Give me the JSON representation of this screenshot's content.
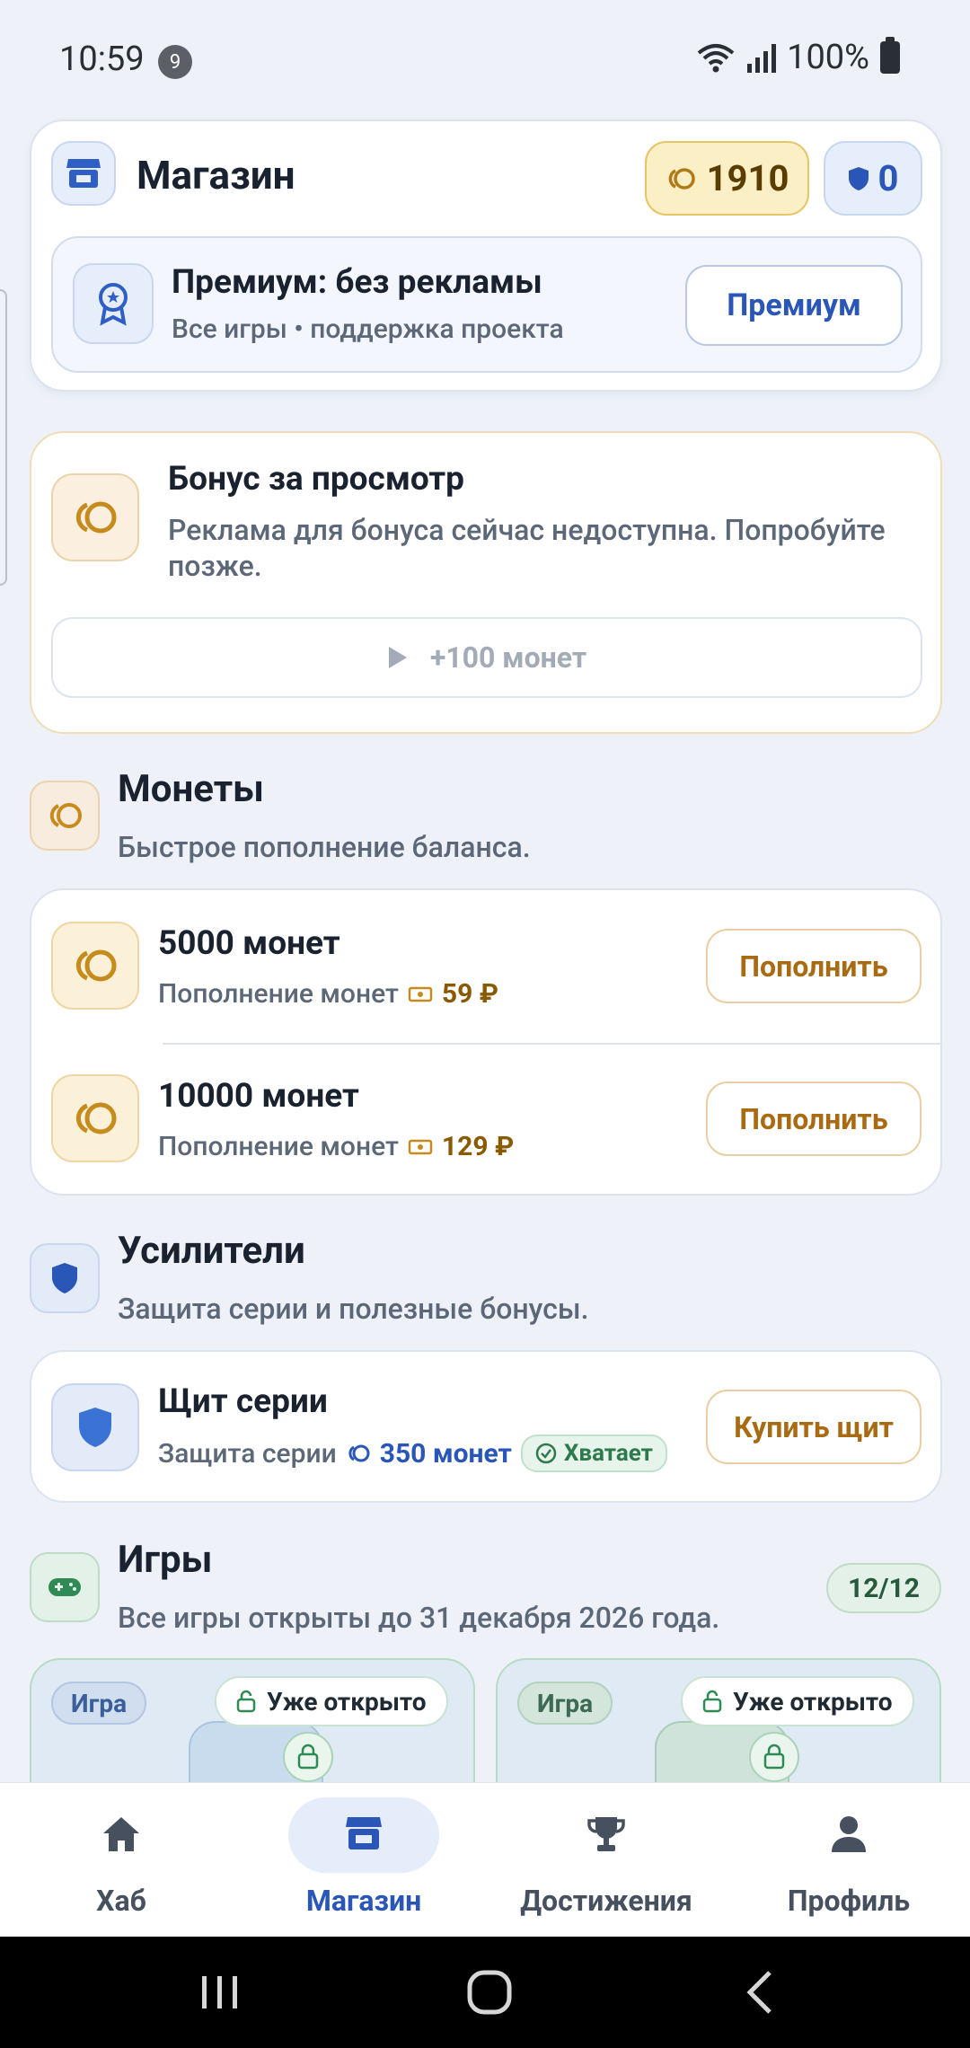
{
  "status_bar": {
    "time": "10:59",
    "notification_count": "9",
    "battery": "100%"
  },
  "header": {
    "title": "Магазин",
    "coins": "1910",
    "shields": "0",
    "premium": {
      "title": "Премиум: без рекламы",
      "subtitle": "Все игры • поддержка проекта",
      "button": "Премиум"
    }
  },
  "bonus": {
    "title": "Бонус за просмотр",
    "subtitle": "Реклама для бонуса сейчас недоступна. Попробуйте позже.",
    "button": "+100 монет"
  },
  "coins_section": {
    "title": "Монеты",
    "subtitle": "Быстрое пополнение баланса.",
    "items": [
      {
        "title": "5000 монет",
        "subtitle": "Пополнение монет",
        "price": "59 ₽",
        "button": "Пополнить"
      },
      {
        "title": "10000 монет",
        "subtitle": "Пополнение монет",
        "price": "129 ₽",
        "button": "Пополнить"
      }
    ]
  },
  "boosters_section": {
    "title": "Усилители",
    "subtitle": "Защита серии и полезные бонусы.",
    "shield": {
      "title": "Щит серии",
      "subtitle": "Защита серии",
      "price": "350 монет",
      "status": "Хватает",
      "button": "Купить щит"
    }
  },
  "games_section": {
    "title": "Игры",
    "subtitle": "Все игры открыты до 31 декабря 2026 года.",
    "count": "12/12",
    "cards": [
      {
        "tag": "Игра",
        "status": "Уже открыто"
      },
      {
        "tag": "Игра",
        "status": "Уже открыто"
      }
    ]
  },
  "bottom_nav": [
    {
      "label": "Хаб",
      "icon": "home-icon",
      "active": false
    },
    {
      "label": "Магазин",
      "icon": "store-icon",
      "active": true
    },
    {
      "label": "Достижения",
      "icon": "trophy-icon",
      "active": false
    },
    {
      "label": "Профиль",
      "icon": "person-icon",
      "active": false
    }
  ],
  "colors": {
    "accent_blue": "#2a56b8",
    "gold": "#a86a12",
    "green": "#2f7a4d",
    "background": "#eef2f8"
  }
}
